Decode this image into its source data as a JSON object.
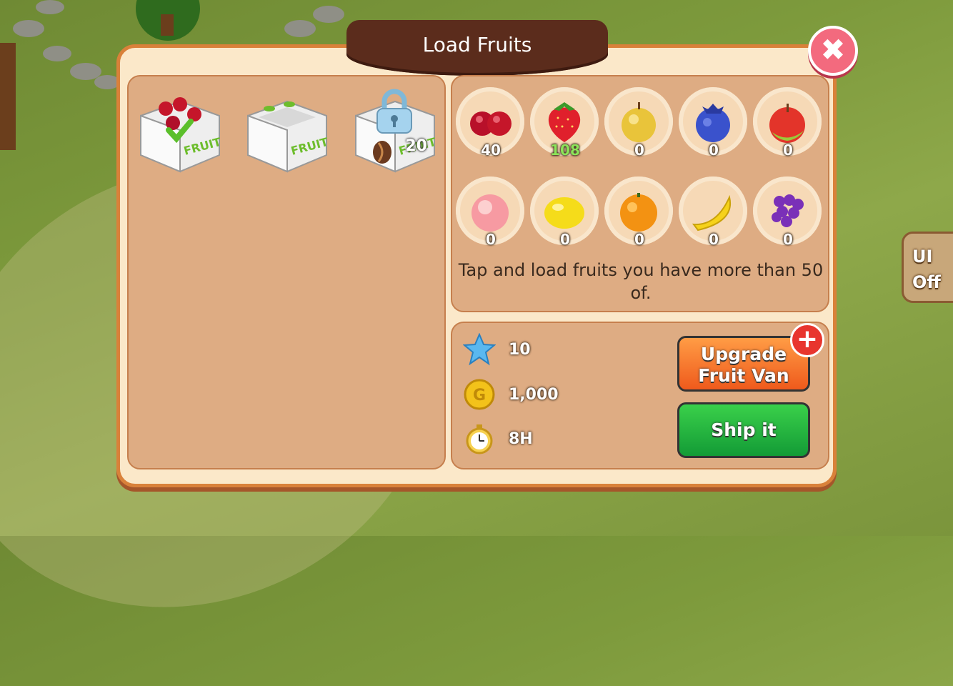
{
  "dialog": {
    "title": "Load Fruits",
    "close_icon": "close-icon"
  },
  "crates": [
    {
      "name": "crate-1",
      "state": "loaded",
      "icon": "check-icon"
    },
    {
      "name": "crate-2",
      "state": "empty"
    },
    {
      "name": "crate-3",
      "state": "locked",
      "unlock_cost": "20",
      "cost_icon": "coffee-bean-icon"
    }
  ],
  "fruits": [
    {
      "name": "cherry",
      "count": "40"
    },
    {
      "name": "strawberry",
      "count": "108"
    },
    {
      "name": "pear",
      "count": "0"
    },
    {
      "name": "blueberry",
      "count": "0"
    },
    {
      "name": "apple",
      "count": "0"
    },
    {
      "name": "peach",
      "count": "0"
    },
    {
      "name": "lemon",
      "count": "0"
    },
    {
      "name": "orange",
      "count": "0"
    },
    {
      "name": "banana",
      "count": "0"
    },
    {
      "name": "grape",
      "count": "0"
    }
  ],
  "hint": "Tap and load fruits you have more than 50 of.",
  "shipment": {
    "stars": "10",
    "gold": "1,000",
    "time": "8H"
  },
  "buttons": {
    "upgrade": "Upgrade Fruit Van",
    "ship": "Ship it"
  },
  "ui_toggle": {
    "line1": "UI",
    "line2": "Off"
  }
}
